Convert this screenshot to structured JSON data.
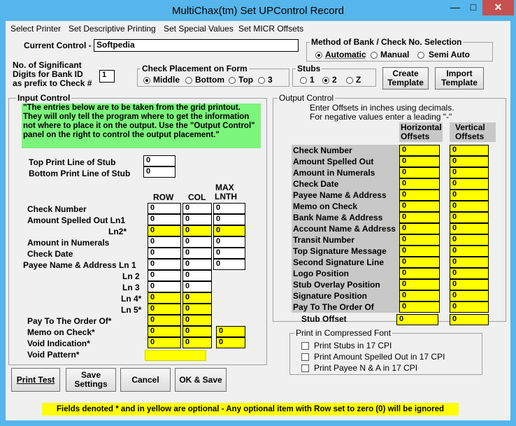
{
  "window": {
    "title": "MultiChax(tm) Set UPControl Record"
  },
  "menu": [
    "Select Printer",
    "Set Descriptive Printing",
    "Set Special Values",
    "Set MICR Offsets"
  ],
  "current_control": {
    "label": "Current Control -",
    "value": "Softpedia"
  },
  "method": {
    "legend": "Method of Bank / Check No. Selection",
    "options": [
      "Automatic",
      "Manual",
      "Semi Auto"
    ],
    "selected": "Automatic"
  },
  "sig_digits": {
    "label1": "No. of Significant",
    "label2": "Digits for Bank ID",
    "label3": "as prefix to Check #",
    "value": "1"
  },
  "placement": {
    "legend": "Check Placement on Form",
    "options": [
      "Middle",
      "Bottom",
      "Top",
      "3"
    ],
    "selected": "Middle"
  },
  "stubs": {
    "legend": "Stubs",
    "options": [
      "1",
      "2",
      "Z"
    ],
    "selected": "2"
  },
  "buttons_top": {
    "create": "Create Template",
    "import": "Import Template"
  },
  "input_control": {
    "legend": "Input Control",
    "note": "\"The entries below are to be taken from the grid printout. They will only tell the program where to get the information not where to place it on the output.  Use the \"Output Control\" panel on the right to control the output placement.\"",
    "top_print_label": "Top Print Line of Stub",
    "top_print_value": "0",
    "bottom_print_label": "Bottom Print Line of Stub",
    "bottom_print_value": "0",
    "col_row": "ROW",
    "col_col": "COL",
    "col_max1": "MAX",
    "col_max2": "LNTH",
    "rows": [
      {
        "label": "Check Number",
        "row": "0",
        "col": "0",
        "max": "0"
      },
      {
        "label": "Amount Spelled Out Ln1",
        "row": "0",
        "col": "0",
        "max": "0"
      },
      {
        "label": "Ln2*",
        "row": "0",
        "col": "0",
        "max": "0"
      },
      {
        "label": "Amount in Numerals",
        "row": "0",
        "col": "0",
        "max": "0"
      },
      {
        "label": "Check Date",
        "row": "0",
        "col": "0",
        "max": "0"
      },
      {
        "label": "Payee Name & Address Ln 1",
        "row": "0",
        "col": "0",
        "max": "0"
      },
      {
        "label": "Ln 2",
        "row": "0",
        "col": "0"
      },
      {
        "label": "Ln 3",
        "row": "0",
        "col": "0"
      },
      {
        "label": "Ln 4*",
        "row": "0",
        "col": "0"
      },
      {
        "label": "Ln 5*",
        "row": "0",
        "col": "0"
      },
      {
        "label": "Pay To The Order Of*",
        "row": "0",
        "col": "0"
      },
      {
        "label": "Memo on Check*",
        "row": "0",
        "col": "0",
        "max": "0"
      },
      {
        "label": "Void Indication*",
        "row": "0",
        "col": "0",
        "max": "0"
      },
      {
        "label": "Void Pattern*",
        "row": ""
      }
    ]
  },
  "output_control": {
    "legend": "Output Control",
    "instr1": "Enter Offsets in inches using decimals.",
    "instr2": "For negative values enter a leading \"-\"",
    "h1": "Horizontal",
    "h2": "Offsets",
    "v1": "Vertical",
    "v2": "Offsets",
    "rows": [
      {
        "label": "Check Number",
        "h": "0",
        "v": "0"
      },
      {
        "label": "Amount Spelled Out",
        "h": "0",
        "v": "0"
      },
      {
        "label": "Amount in Numerals",
        "h": "0",
        "v": "0"
      },
      {
        "label": "Check Date",
        "h": "0",
        "v": "0"
      },
      {
        "label": "Payee Name & Address",
        "h": "0",
        "v": "0"
      },
      {
        "label": "Memo on Check",
        "h": "0",
        "v": "0"
      },
      {
        "label": "Bank Name & Address",
        "h": "0",
        "v": "0"
      },
      {
        "label": "Account Name & Address",
        "h": "0",
        "v": "0"
      },
      {
        "label": "Transit Number",
        "h": "0",
        "v": "0"
      },
      {
        "label": "Top Signature Message",
        "h": "0",
        "v": "0"
      },
      {
        "label": "Second Signature Line",
        "h": "0",
        "v": "0"
      },
      {
        "label": "Logo Position",
        "h": "0",
        "v": "0"
      },
      {
        "label": "Stub Overlay Position",
        "h": "0",
        "v": "0"
      },
      {
        "label": "Signature Position",
        "h": "0",
        "v": "0"
      },
      {
        "label": "Pay To The Order Of",
        "h": "0",
        "v": "0"
      },
      {
        "label": "Stub Offset",
        "h": "0",
        "v": "0"
      }
    ]
  },
  "compressed": {
    "legend": "Print in Compressed Font",
    "options": [
      "Print Stubs in 17 CPI",
      "Print Amount Spelled Out in 17 CPI",
      "Print Payee N & A in 17 CPI"
    ]
  },
  "bottom_buttons": {
    "print_test": "Print Test",
    "save_settings": "Save Settings",
    "cancel": "Cancel",
    "ok_save": "OK & Save"
  },
  "footer_note": "Fields denoted * and in yellow are optional - Any optional item with Row set to zero (0) will be ignored",
  "colors": {
    "frame": "#56b5ea",
    "optional": "#ffff00",
    "note_green": "#7cf57c",
    "close_button": "#c75050"
  }
}
